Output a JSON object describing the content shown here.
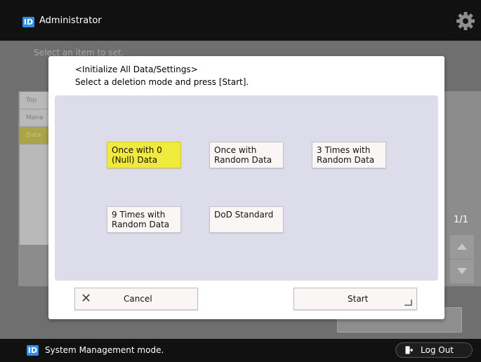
{
  "header": {
    "badge": "ID",
    "title": "Administrator",
    "settings_icon": "gear-icon"
  },
  "background": {
    "select_prompt": "Select an item to set.",
    "list_items": [
      "Top",
      "Mana",
      "Data"
    ],
    "selected_index": 2,
    "pager": "1/1"
  },
  "modal": {
    "heading": "<Initialize All Data/Settings>",
    "instruction": "Select a deletion mode and press [Start].",
    "options": [
      {
        "line1": "Once with 0",
        "line2": "(Null) Data",
        "selected": true
      },
      {
        "line1": "Once with",
        "line2": "Random Data",
        "selected": false
      },
      {
        "line1": "3 Times with",
        "line2": "Random Data",
        "selected": false
      },
      {
        "line1": "9 Times with",
        "line2": "Random Data",
        "selected": false
      },
      {
        "line1": "DoD Standard",
        "line2": "",
        "selected": false
      }
    ],
    "cancel_label": "Cancel",
    "start_label": "Start"
  },
  "footer": {
    "badge": "ID",
    "status": "System Management mode.",
    "logout_label": "Log Out"
  },
  "colors": {
    "accent_blue": "#2f8fe8",
    "selected_yellow": "#f0ea3c",
    "options_background": "#dcdcea"
  }
}
